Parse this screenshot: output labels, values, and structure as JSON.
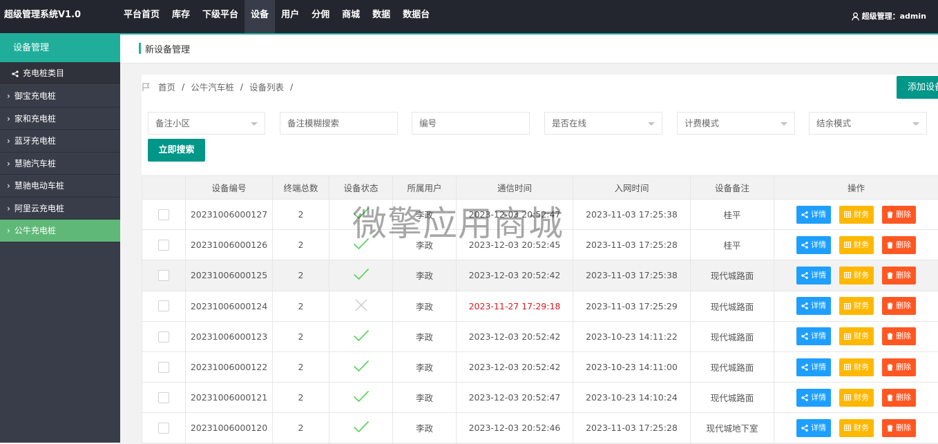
{
  "app": {
    "title": "超级管理系统V1.0"
  },
  "topnav": [
    {
      "label": "平台首页",
      "active": false
    },
    {
      "label": "库存",
      "active": false
    },
    {
      "label": "下级平台",
      "active": false
    },
    {
      "label": "设备",
      "active": true
    },
    {
      "label": "用户",
      "active": false
    },
    {
      "label": "分佣",
      "active": false
    },
    {
      "label": "商城",
      "active": false
    },
    {
      "label": "数据",
      "active": false
    },
    {
      "label": "数据台",
      "active": false
    }
  ],
  "user": {
    "label": "超级管理：admin"
  },
  "sidebar": {
    "header": "设备管理",
    "category": "充电桩类目",
    "items": [
      {
        "label": "御宝充电桩",
        "active": false
      },
      {
        "label": "家和充电桩",
        "active": false
      },
      {
        "label": "蓝牙充电桩",
        "active": false
      },
      {
        "label": "慧驰汽车桩",
        "active": false
      },
      {
        "label": "慧驰电动车桩",
        "active": false
      },
      {
        "label": "阿里云充电桩",
        "active": false
      },
      {
        "label": "公牛充电桩",
        "active": true
      }
    ]
  },
  "page": {
    "title": "新设备管理"
  },
  "breadcrumb": [
    "首页",
    "公牛汽车桩",
    "设备列表"
  ],
  "add_button": "添加设备",
  "filters": {
    "community": "备注小区",
    "remark_search": "备注模糊搜索",
    "number": "编号",
    "online": "是否在线",
    "billing_mode": "计费模式",
    "balance_mode": "结余模式",
    "search_button": "立即搜索"
  },
  "table": {
    "headers": [
      "",
      "设备编号",
      "终端总数",
      "设备状态",
      "所属用户",
      "通信时间",
      "入网时间",
      "设备备注",
      "操作"
    ],
    "rows": [
      {
        "id": "20231006000127",
        "terminals": "2",
        "status": "ok",
        "user": "李政",
        "comm_time": "2023-12-03 20:52:47",
        "net_time": "2023-11-03 17:25:38",
        "remark": "桂平",
        "comm_alert": false
      },
      {
        "id": "20231006000126",
        "terminals": "2",
        "status": "ok",
        "user": "李政",
        "comm_time": "2023-12-03 20:52:45",
        "net_time": "2023-11-03 17:25:28",
        "remark": "桂平",
        "comm_alert": false
      },
      {
        "id": "20231006000125",
        "terminals": "2",
        "status": "ok",
        "user": "李政",
        "comm_time": "2023-12-03 20:52:42",
        "net_time": "2023-11-03 17:25:38",
        "remark": "现代城路面",
        "comm_alert": false
      },
      {
        "id": "20231006000124",
        "terminals": "2",
        "status": "offline",
        "user": "李政",
        "comm_time": "2023-11-27 17:29:18",
        "net_time": "2023-11-03 17:25:29",
        "remark": "现代城路面",
        "comm_alert": true
      },
      {
        "id": "20231006000123",
        "terminals": "2",
        "status": "ok",
        "user": "李政",
        "comm_time": "2023-12-03 20:52:42",
        "net_time": "2023-10-23 14:11:22",
        "remark": "现代城路面",
        "comm_alert": false
      },
      {
        "id": "20231006000122",
        "terminals": "2",
        "status": "ok",
        "user": "李政",
        "comm_time": "2023-12-03 20:52:42",
        "net_time": "2023-10-23 14:11:00",
        "remark": "现代城路面",
        "comm_alert": false
      },
      {
        "id": "20231006000121",
        "terminals": "2",
        "status": "ok",
        "user": "李政",
        "comm_time": "2023-12-03 20:52:47",
        "net_time": "2023-10-23 14:10:24",
        "remark": "现代城路面",
        "comm_alert": false
      },
      {
        "id": "20231006000120",
        "terminals": "2",
        "status": "ok",
        "user": "李政",
        "comm_time": "2023-12-03 20:52:46",
        "net_time": "2023-11-03 17:25:28",
        "remark": "现代城地下室",
        "comm_alert": false
      }
    ],
    "highlight_row": 2
  },
  "actions": {
    "detail": "详情",
    "finance": "财务",
    "delete": "删除"
  },
  "watermark": "微擎应用商城",
  "colors": {
    "accent": "#009688",
    "sidebar_active": "#5fb878",
    "blue": "#1e9fff",
    "yellow": "#ffb800",
    "orange": "#ff5722",
    "alert": "#e0181c",
    "ok_check": "#5fd35f"
  }
}
